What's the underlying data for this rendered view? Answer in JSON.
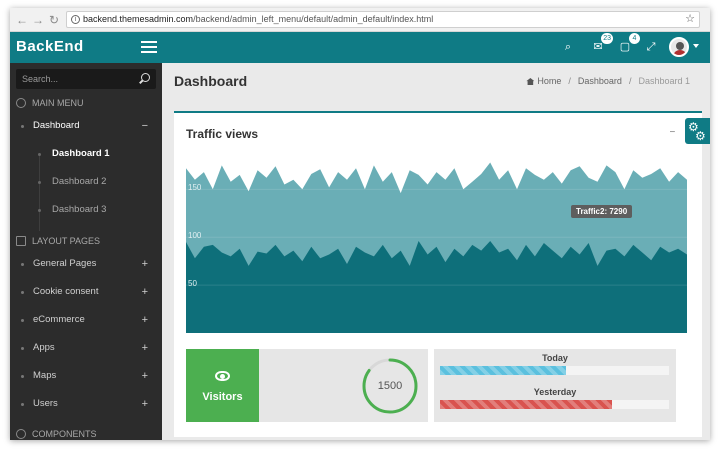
{
  "browser": {
    "url_host": "backend.themesadmin.com",
    "url_path": "/backend/admin_left_menu/default/admin_default/index.html"
  },
  "header": {
    "brand": "BackEnd",
    "badges": {
      "messages": "23",
      "notifications": "4"
    }
  },
  "sidebar": {
    "search_placeholder": "Search...",
    "sections": {
      "main_menu": "Main Menu",
      "layout_pages": "Layout Pages",
      "components": "Components"
    },
    "main_items": [
      {
        "label": "Dashboard",
        "toggle": "−"
      }
    ],
    "dashboard_sub": [
      "Dashboard 1",
      "Dashboard 2",
      "Dashboard 3"
    ],
    "layout_items": [
      {
        "label": "General Pages",
        "toggle": "+"
      },
      {
        "label": "Cookie consent",
        "toggle": "+"
      },
      {
        "label": "eCommerce",
        "toggle": "+"
      },
      {
        "label": "Apps",
        "toggle": "+"
      },
      {
        "label": "Maps",
        "toggle": "+"
      },
      {
        "label": "Users",
        "toggle": "+"
      }
    ]
  },
  "main": {
    "title": "Dashboard",
    "breadcrumb": [
      "Home",
      "Dashboard",
      "Dashboard 1"
    ],
    "card": {
      "title": "Traffic views",
      "tools": {
        "collapse": "−",
        "close": "×"
      },
      "tooltip": "Traffic2: 7290"
    },
    "visitors": {
      "label": "Visitors",
      "value": "1500",
      "ring_fraction": 0.85
    },
    "traffic": {
      "today": {
        "label": "Today",
        "fraction": 0.55,
        "color": "#5bc0de"
      },
      "yesterday": {
        "label": "Yesterday",
        "fraction": 0.75,
        "color": "#d9534f"
      }
    }
  },
  "colors": {
    "brand": "#0f7b85",
    "sidebar": "#2c2c2c",
    "area_light": "#6aaeb6",
    "area_dark": "#0e6f7a",
    "visitors": "#4caf50"
  },
  "chart_data": {
    "type": "area",
    "yticks": [
      "150",
      "100",
      "50"
    ],
    "ylim": [
      0,
      190
    ],
    "series": [
      {
        "values": [
          172,
          160,
          168,
          150,
          175,
          158,
          165,
          148,
          170,
          162,
          174,
          155,
          160,
          150,
          166,
          171,
          152,
          168,
          160,
          172,
          150,
          175,
          158,
          168,
          146,
          170,
          165,
          155,
          168,
          160,
          172,
          150,
          158,
          166,
          178,
          160,
          170,
          150,
          172,
          165,
          160,
          168,
          156,
          170,
          174,
          162,
          158,
          175,
          168,
          150,
          170,
          162,
          166,
          172,
          158,
          168,
          160
        ]
      },
      {
        "values": [
          95,
          78,
          90,
          92,
          84,
          80,
          88,
          70,
          85,
          83,
          92,
          80,
          86,
          75,
          90,
          78,
          82,
          88,
          72,
          90,
          84,
          80,
          92,
          78,
          86,
          70,
          96,
          82,
          90,
          74,
          88,
          80,
          92,
          86,
          96,
          84,
          88,
          76,
          92,
          80,
          94,
          86,
          78,
          90,
          82,
          94,
          70,
          86,
          88,
          80,
          92,
          84,
          76,
          90,
          84,
          88,
          82
        ]
      }
    ]
  }
}
